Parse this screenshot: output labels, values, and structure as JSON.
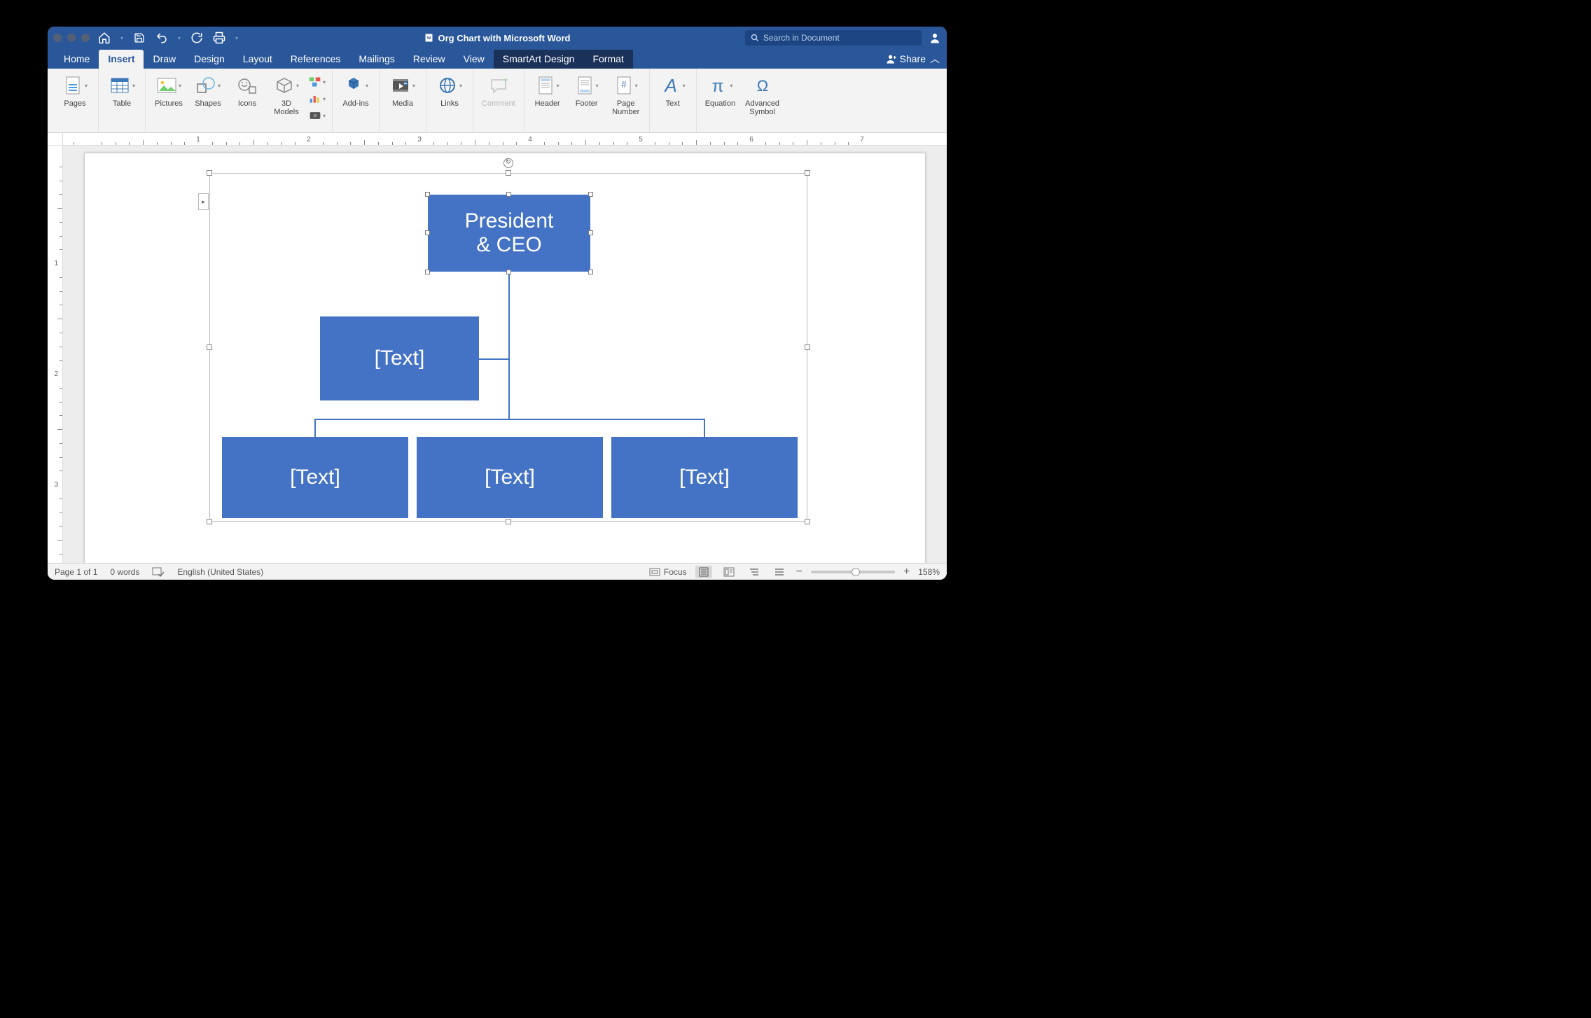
{
  "titlebar": {
    "document_title": "Org Chart with Microsoft Word",
    "search_placeholder": "Search in Document"
  },
  "tabs": {
    "home": "Home",
    "insert": "Insert",
    "draw": "Draw",
    "design": "Design",
    "layout": "Layout",
    "references": "References",
    "mailings": "Mailings",
    "review": "Review",
    "view": "View",
    "smartart_design": "SmartArt Design",
    "format": "Format",
    "share": "Share"
  },
  "ribbon": {
    "pages": "Pages",
    "table": "Table",
    "pictures": "Pictures",
    "shapes": "Shapes",
    "icons": "Icons",
    "models3d": "3D\nModels",
    "addins": "Add-ins",
    "media": "Media",
    "links": "Links",
    "comment": "Comment",
    "header": "Header",
    "footer": "Footer",
    "page_number": "Page\nNumber",
    "text": "Text",
    "equation": "Equation",
    "advanced_symbol": "Advanced\nSymbol"
  },
  "smartart": {
    "top_node": "President\n& CEO",
    "placeholder": "[Text]"
  },
  "statusbar": {
    "page": "Page 1 of 1",
    "words": "0 words",
    "language": "English (United States)",
    "focus": "Focus",
    "zoom": "158%"
  },
  "ruler": {
    "marks": [
      "1",
      "2",
      "3",
      "4",
      "5",
      "6",
      "7"
    ]
  }
}
